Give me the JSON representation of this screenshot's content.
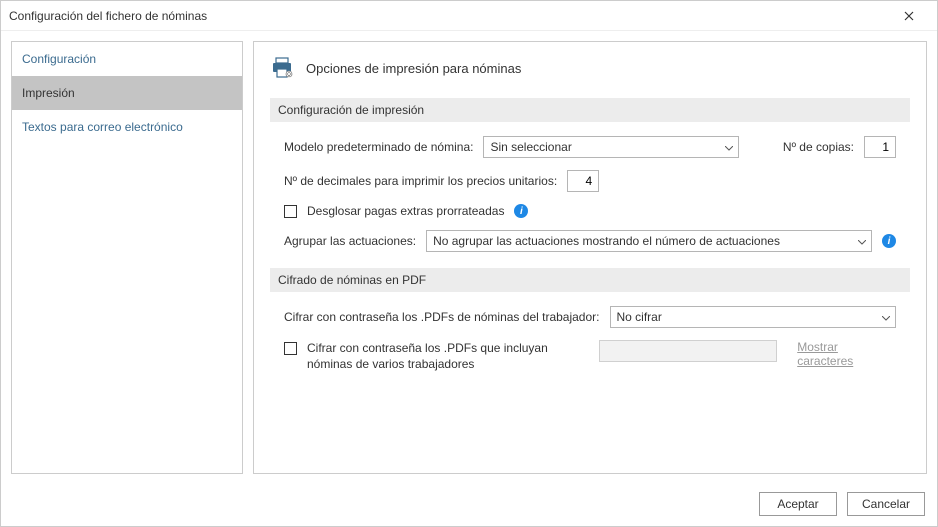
{
  "window": {
    "title": "Configuración del fichero de nóminas"
  },
  "sidebar": {
    "items": [
      {
        "label": "Configuración"
      },
      {
        "label": "Impresión"
      },
      {
        "label": "Textos para correo electrónico"
      }
    ]
  },
  "page": {
    "title": "Opciones de impresión para nóminas"
  },
  "sections": {
    "print": {
      "header": "Configuración de impresión",
      "model_label": "Modelo predeterminado de nómina:",
      "model_value": "Sin seleccionar",
      "copies_label": "Nº de copias:",
      "copies_value": "1",
      "decimals_label": "Nº de decimales para imprimir los precios unitarios:",
      "decimals_value": "4",
      "breakdown_label": "Desglosar pagas extras prorrateadas",
      "group_label": "Agrupar las actuaciones:",
      "group_value": "No agrupar las actuaciones mostrando el número de actuaciones"
    },
    "pdf": {
      "header": "Cifrado de nóminas en PDF",
      "encrypt_worker_label": "Cifrar con contraseña los .PDFs de nóminas del trabajador:",
      "encrypt_worker_value": "No cifrar",
      "encrypt_multi_label": "Cifrar con contraseña los .PDFs que incluyan nóminas de varios trabajadores",
      "show_chars": "Mostrar caracteres"
    }
  },
  "footer": {
    "accept": "Aceptar",
    "cancel": "Cancelar"
  }
}
